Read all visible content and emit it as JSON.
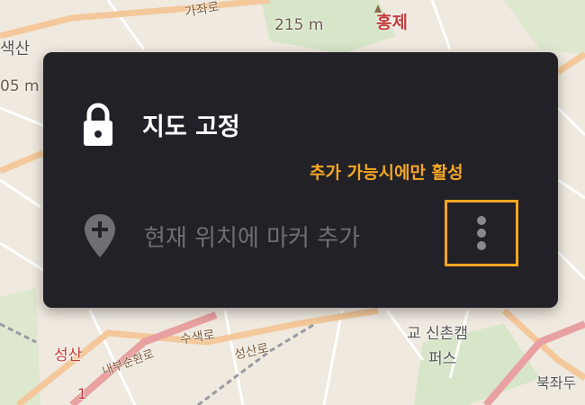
{
  "map": {
    "labels": {
      "elevation_top": "215 m",
      "district_top": "홍제",
      "road_top": "가좌로",
      "area_left": "색산",
      "elevation_left": "05 m",
      "station_bottom": "교 신촌캠",
      "station_bottom2": "퍼스",
      "area_seongsan": "성산",
      "road_seongsan": "성산로",
      "road_susaek": "수색로",
      "road_bottom": "내부순환로",
      "area_bukjwa": "북좌두",
      "number_bottom": "1"
    },
    "colors": {
      "road": "#f4c89a",
      "park": "#cfe3c2",
      "major_road": "#e8a0a0"
    }
  },
  "dialog": {
    "lock": {
      "icon": "lock-icon",
      "label": "지도 고정"
    },
    "annotation": "추가 가능시에만 활성",
    "marker": {
      "icon": "map-pin-plus-icon",
      "label": "현재 위치에 마커 추가"
    },
    "more": {
      "icon": "more-vertical-icon"
    },
    "colors": {
      "background": "#222127",
      "text": "#ffffff",
      "disabled": "#6f6e74",
      "highlight": "#f5a623"
    }
  }
}
